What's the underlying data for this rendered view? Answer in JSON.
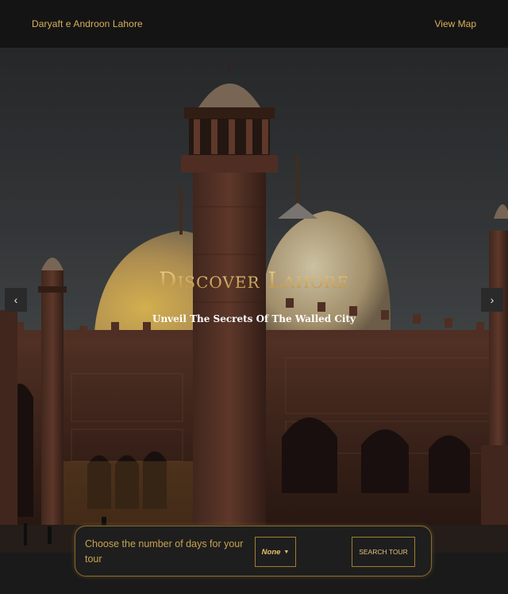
{
  "nav": {
    "brand": "Daryaft e Androon Lahore",
    "view_map": "View Map"
  },
  "hero": {
    "title": "Discover Lahore",
    "subtitle": "Unveil The Secrets Of The Walled City",
    "prev_icon": "chevron-left-icon",
    "next_icon": "chevron-right-icon",
    "image": "badshahi-mosque-photo"
  },
  "tour": {
    "label": "Choose the number of days for your tour",
    "select_value": "None",
    "search_label": "SEARCH TOUR"
  },
  "colors": {
    "accent_gold": "#d8b15c",
    "background": "#141414"
  }
}
